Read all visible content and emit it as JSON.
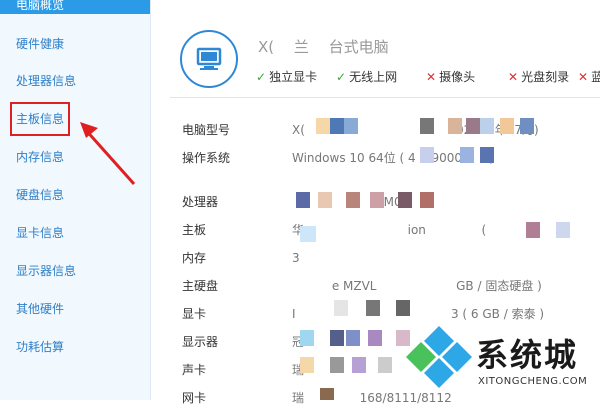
{
  "sidebar": {
    "header": "电脑概览",
    "items": [
      {
        "label": "硬件健康"
      },
      {
        "label": "处理器信息"
      },
      {
        "label": "主板信息"
      },
      {
        "label": "内存信息"
      },
      {
        "label": "硬盘信息"
      },
      {
        "label": "显卡信息"
      },
      {
        "label": "显示器信息"
      },
      {
        "label": "其他硬件"
      },
      {
        "label": "功耗估算"
      }
    ],
    "active_index": 2
  },
  "summary": {
    "title": "X( 　兰　 台式电脑",
    "features": [
      {
        "status": "ok",
        "label": "独立显卡"
      },
      {
        "status": "ok",
        "label": "无线上网"
      },
      {
        "status": "no",
        "label": "摄像头"
      },
      {
        "status": "no",
        "label": "光盘刻录"
      },
      {
        "status": "no",
        "label": "蓝"
      }
    ]
  },
  "specs": {
    "model": {
      "label": "电脑型号",
      "value": "X( 　　　　　　 　　　　　 2020 　年07月)"
    },
    "os": {
      "label": "操作系统",
      "value": "Windows 10 64位 ( 4 　9000 0 　)"
    }
  },
  "hardware": [
    {
      "label": "处理器",
      "value": "　　　　 　　　 M00 　"
    },
    {
      "label": "主板",
      "value": "华 　　　　　　　　 ion 　　　　 ( 　 　"
    },
    {
      "label": "内存",
      "value": "3 　　　　　　　　　　　 　"
    },
    {
      "label": "主硬盘",
      "value": "　　 　e MZVL 　　　　　　 GB / 固态硬盘 )"
    },
    {
      "label": "显卡",
      "value": "I 　　　　　　 　　　　　　 3 ( 6 GB / 索泰 )"
    },
    {
      "label": "显示器",
      "value": "冠 　　　　　　　　　　　　　 英寸 )"
    },
    {
      "label": "声卡",
      "value": "瑞 　　　　　　　　　　　　　　　 ntroller"
    },
    {
      "label": "网卡",
      "value": "瑞 　　　　 168/8111/8112 　　　　　　 ntroller"
    }
  ],
  "watermark": {
    "text": "系统城",
    "url": "XITONGCHENG.COM"
  },
  "colors": {
    "accent": "#2b9be8",
    "highlight": "#e02020",
    "ok": "#3aa63a",
    "no": "#e03030"
  }
}
